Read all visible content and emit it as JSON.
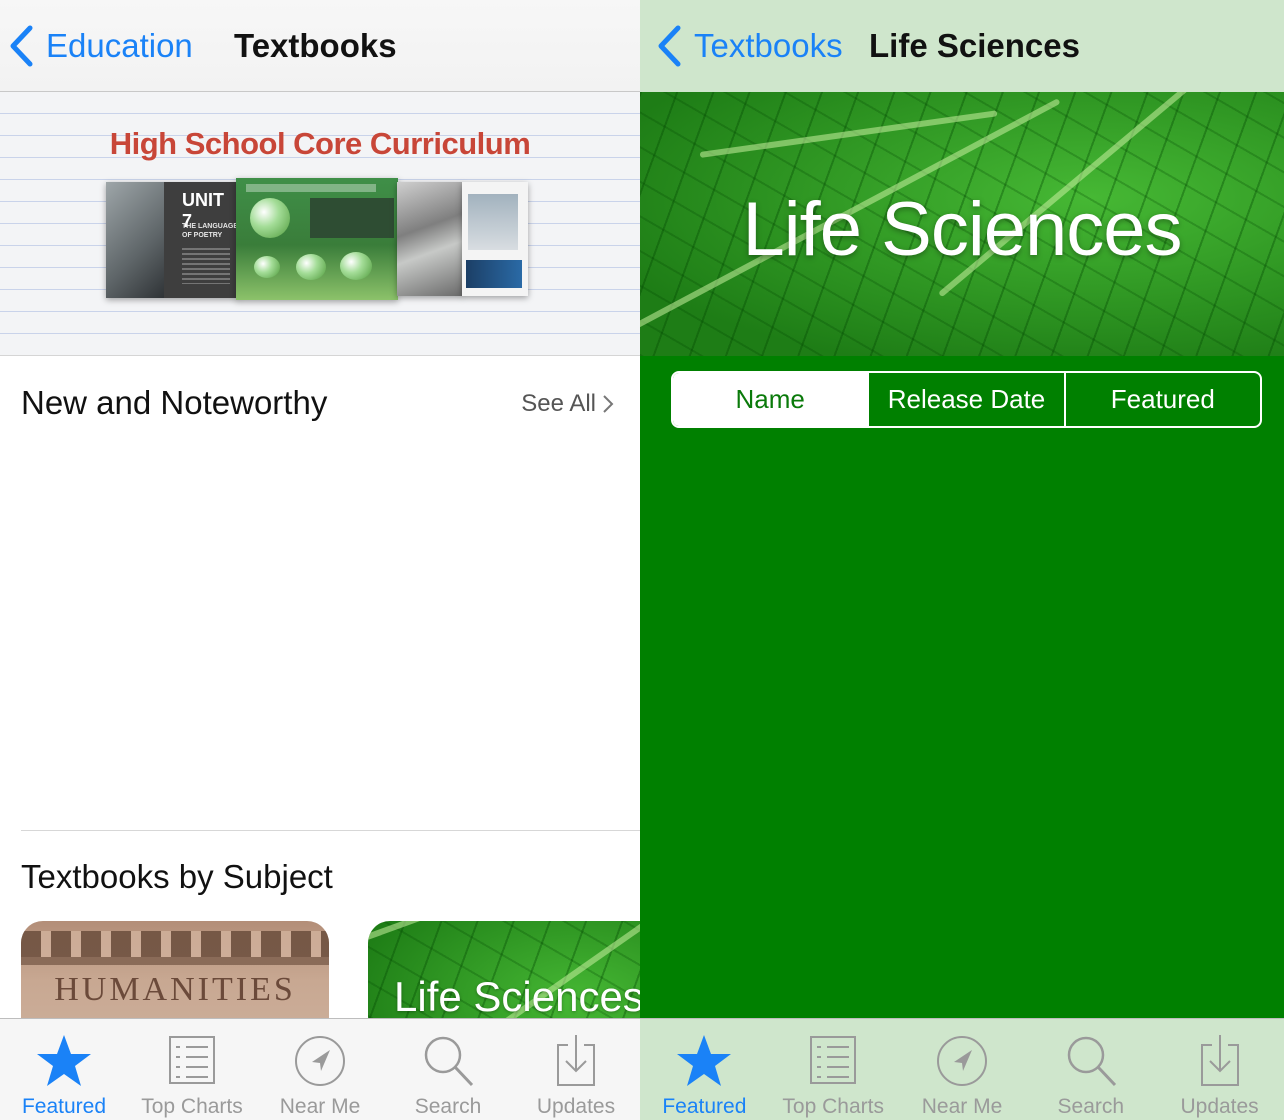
{
  "left": {
    "nav": {
      "back_label": "Education",
      "title": "Textbooks"
    },
    "banner": {
      "title": "High School Core Curriculum",
      "book_unit": "UNIT 7",
      "book_subtitle": "THE LANGUAGE OF POETRY"
    },
    "noteworthy": {
      "title": "New and Noteworthy",
      "see_all": "See All"
    },
    "subjects": {
      "title": "Textbooks by Subject",
      "tiles": [
        "HUMANITIES",
        "Life Sciences"
      ]
    }
  },
  "right": {
    "nav": {
      "back_label": "Textbooks",
      "title": "Life Sciences"
    },
    "hero_title": "Life Sciences",
    "segments": [
      {
        "label": "Name",
        "selected": true
      },
      {
        "label": "Release Date",
        "selected": false
      },
      {
        "label": "Featured",
        "selected": false
      }
    ]
  },
  "tabbar": {
    "items": [
      {
        "label": "Featured",
        "icon": "star-icon",
        "active": true
      },
      {
        "label": "Top Charts",
        "icon": "list-icon",
        "active": false
      },
      {
        "label": "Near Me",
        "icon": "location-icon",
        "active": false
      },
      {
        "label": "Search",
        "icon": "search-icon",
        "active": false
      },
      {
        "label": "Updates",
        "icon": "download-icon",
        "active": false
      }
    ]
  },
  "colors": {
    "accent_blue": "#1a82f7",
    "life_green": "#008000",
    "nav_green": "#cfe6cc"
  }
}
